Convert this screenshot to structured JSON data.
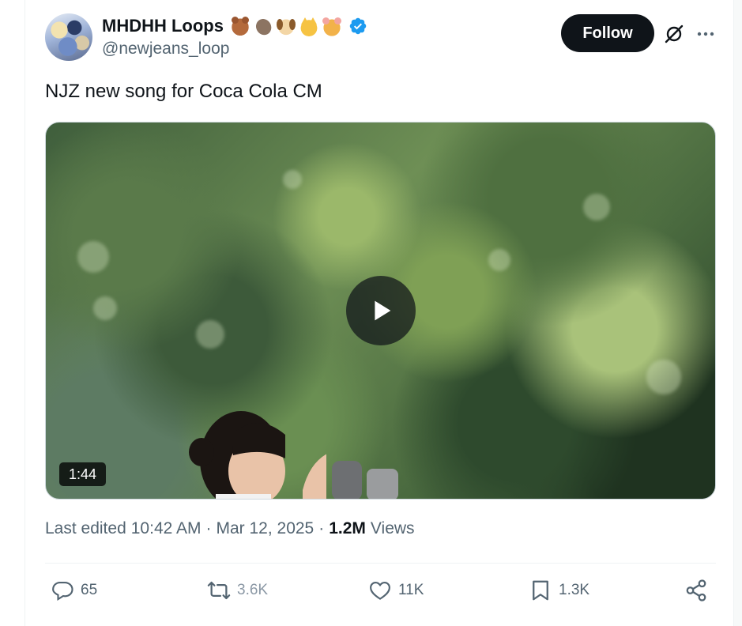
{
  "author": {
    "display_name": "MHDHH Loops",
    "emojis": [
      "teddy-bear",
      "otter",
      "dog-face",
      "cat-face",
      "hamster-face"
    ],
    "verified": true,
    "handle": "@newjeans_loop"
  },
  "actions_top": {
    "follow_label": "Follow"
  },
  "tweet": {
    "text": "NJZ new song for Coca Cola CM"
  },
  "media": {
    "type": "video",
    "duration": "1:44"
  },
  "meta": {
    "edited_prefix": "Last edited",
    "time": "10:42 AM",
    "date": "Mar 12, 2025",
    "separator": "·",
    "views_count": "1.2M",
    "views_label": "Views"
  },
  "engagement": {
    "replies": "65",
    "reposts": "3.6K",
    "likes": "11K",
    "bookmarks": "1.3K"
  },
  "colors": {
    "text_primary": "#0f1419",
    "text_secondary": "#536471",
    "verified_blue": "#1d9bf0",
    "follow_bg": "#0f1419",
    "divider": "#eff3f4"
  },
  "icons": {
    "reply": "speech-bubble-icon",
    "repost": "repost-arrows-icon",
    "like": "heart-icon",
    "bookmark": "bookmark-icon",
    "share": "share-nodes-icon",
    "grok": "grok-slash-circle-icon",
    "more": "ellipsis-icon",
    "play": "play-icon"
  }
}
